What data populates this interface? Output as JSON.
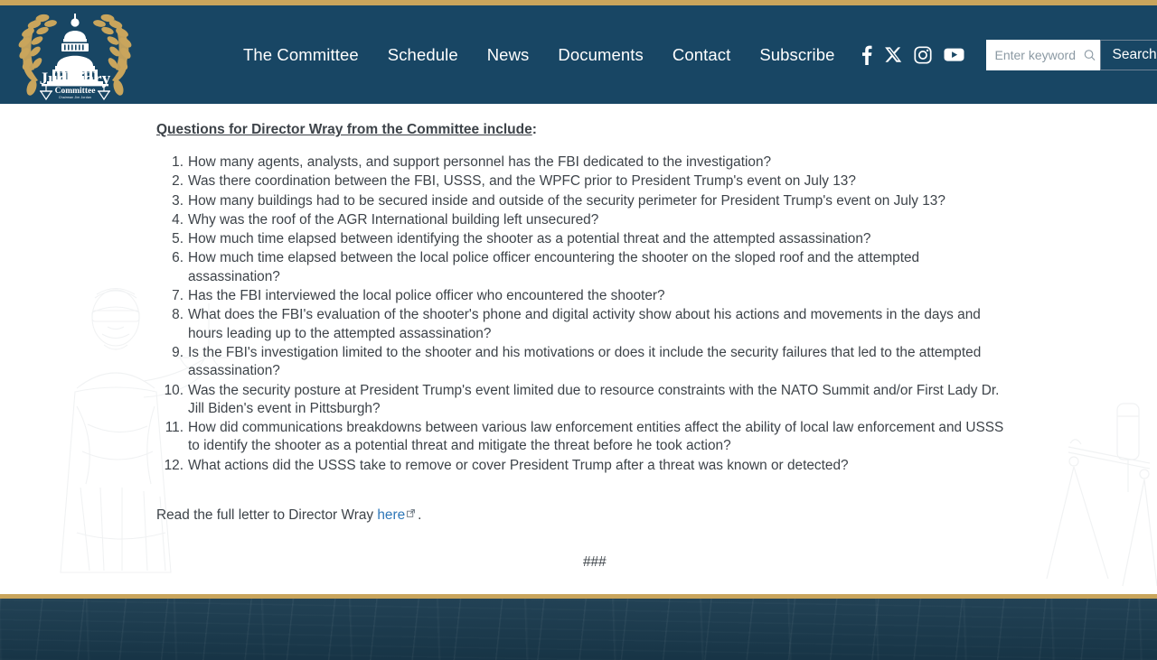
{
  "colors": {
    "gold": "#c9a55c",
    "header_navy": "#184664",
    "footer_navy": "#1a3b4f",
    "body_text": "#3d4349",
    "link_blue": "#2e77b8"
  },
  "header": {
    "logo_alt": "House Judiciary Committee seal",
    "logo_text_main": "Judiciary",
    "logo_text_sub": "Committee",
    "nav": [
      {
        "label": "The Committee",
        "name": "nav-the-committee"
      },
      {
        "label": "Schedule",
        "name": "nav-schedule"
      },
      {
        "label": "News",
        "name": "nav-news"
      },
      {
        "label": "Documents",
        "name": "nav-documents"
      },
      {
        "label": "Contact",
        "name": "nav-contact"
      },
      {
        "label": "Subscribe",
        "name": "nav-subscribe"
      }
    ],
    "social": [
      {
        "icon": "facebook-icon",
        "label": "Facebook"
      },
      {
        "icon": "x-twitter-icon",
        "label": "X"
      },
      {
        "icon": "instagram-icon",
        "label": "Instagram"
      },
      {
        "icon": "youtube-icon",
        "label": "YouTube"
      }
    ],
    "search": {
      "placeholder": "Enter keyword",
      "value": "",
      "icon": "search-icon",
      "button_label": "Search"
    }
  },
  "main": {
    "heading": "Questions for Director Wray from the Committee include",
    "heading_suffix": ":",
    "questions": [
      "How many agents, analysts, and support personnel has the FBI dedicated to the investigation?",
      "Was there coordination between the FBI, USSS, and the WPFC prior to President Trump's event on July 13?",
      "How many buildings had to be secured inside and outside of the security perimeter for President Trump's event on July 13?",
      "Why was the roof of the AGR International building left unsecured?",
      "How much time elapsed between identifying the shooter as a potential threat and the attempted assassination?",
      "How much time elapsed between the local police officer encountering the shooter on the sloped roof and the attempted assassination?",
      "Has the FBI interviewed the local police officer who encountered the shooter?",
      "What does the FBI's evaluation of the shooter's phone and digital activity show about his actions and movements in the days and hours leading up to the attempted assassination?",
      "Is the FBI's investigation limited to the shooter and his motivations or does it include the security failures that led to the attempted assassination?",
      "Was the security posture at President Trump's event limited due to resource constraints with the NATO Summit and/or First Lady Dr. Jill Biden's event in Pittsburgh?",
      "How did communications breakdowns between various law enforcement entities affect the ability of local law enforcement and USSS to identify the shooter as a potential threat and mitigate the threat before he took action?",
      "What actions did the USSS take to remove or cover President Trump after a threat was known or detected?"
    ],
    "read_more_prefix": "Read the full letter to Director Wray ",
    "read_more_link": "here",
    "read_more_icon": "external-link-icon",
    "read_more_suffix": ".",
    "end_mark": "###",
    "watermark_left": "lady-justice-illustration",
    "watermark_right": "scales-of-justice-illustration"
  },
  "footer": {
    "background": "capitol-building-photo"
  }
}
